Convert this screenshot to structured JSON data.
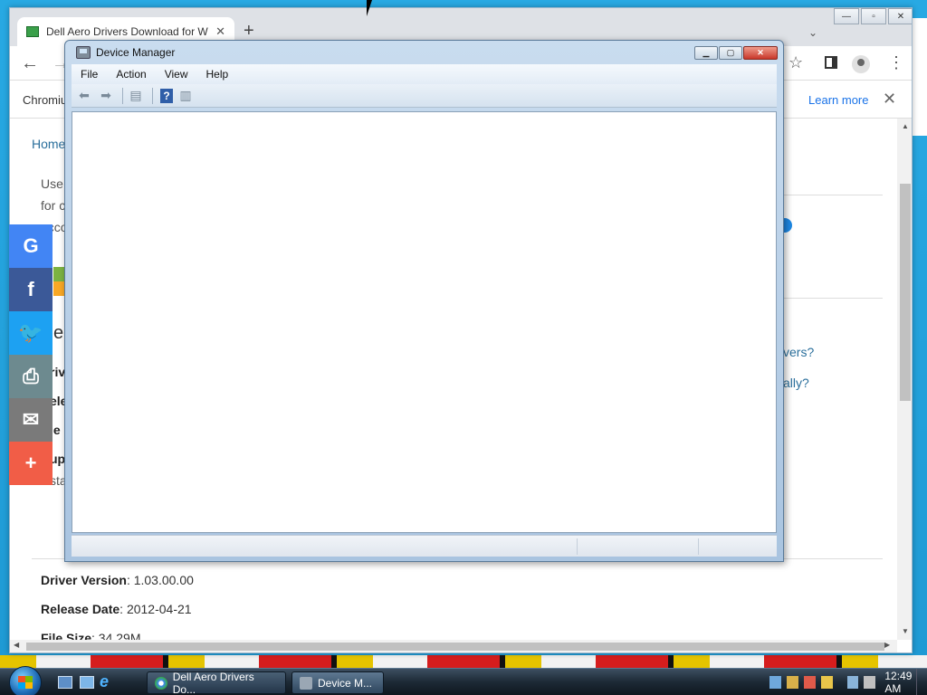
{
  "browser": {
    "tab_title": "Dell Aero Drivers Download for W",
    "tab_close": "✕",
    "new_tab": "+",
    "dropdown": "⌄",
    "window_controls": {
      "minimize": "—",
      "maximize": "▫",
      "close": "✕"
    },
    "infobar": {
      "text": "Chromiu",
      "learn_more": "Learn more",
      "close": "✕"
    }
  },
  "page": {
    "breadcrumb_home": "Home",
    "paragraph_lines": [
      "Use",
      "for c",
      "acco"
    ],
    "fragment_e": "e",
    "bold_fragments": [
      "riv",
      "ele",
      "le",
      "up"
    ],
    "fragment_sta": "sta",
    "side_links": [
      "vers?",
      "ally?"
    ],
    "driver_version_label": "Driver Version",
    "driver_version_value": ": 1.03.00.00",
    "release_date_label": "Release Date",
    "release_date_value": ": 2012-04-21",
    "file_size_label": "File Size",
    "file_size_value": ": 34.29M"
  },
  "share_bar": [
    {
      "name": "google",
      "glyph": "G",
      "color": "#4285f4"
    },
    {
      "name": "facebook",
      "glyph": "f",
      "color": "#3b5998"
    },
    {
      "name": "twitter",
      "glyph": "🐦",
      "color": "#1da1f2"
    },
    {
      "name": "print",
      "glyph": "⎙",
      "color": "#6d8a8f"
    },
    {
      "name": "email",
      "glyph": "✉",
      "color": "#7a7a7a"
    },
    {
      "name": "more",
      "glyph": "+",
      "color": "#f15d47"
    }
  ],
  "device_manager": {
    "title": "Device Manager",
    "menus": [
      "File",
      "Action",
      "View",
      "Help"
    ],
    "help_glyph": "?"
  },
  "taskbar": {
    "tasks": [
      {
        "label": "Dell Aero Drivers Do...",
        "active": false
      },
      {
        "label": "Device M...",
        "active": true
      }
    ],
    "clock": "12:49 AM"
  }
}
